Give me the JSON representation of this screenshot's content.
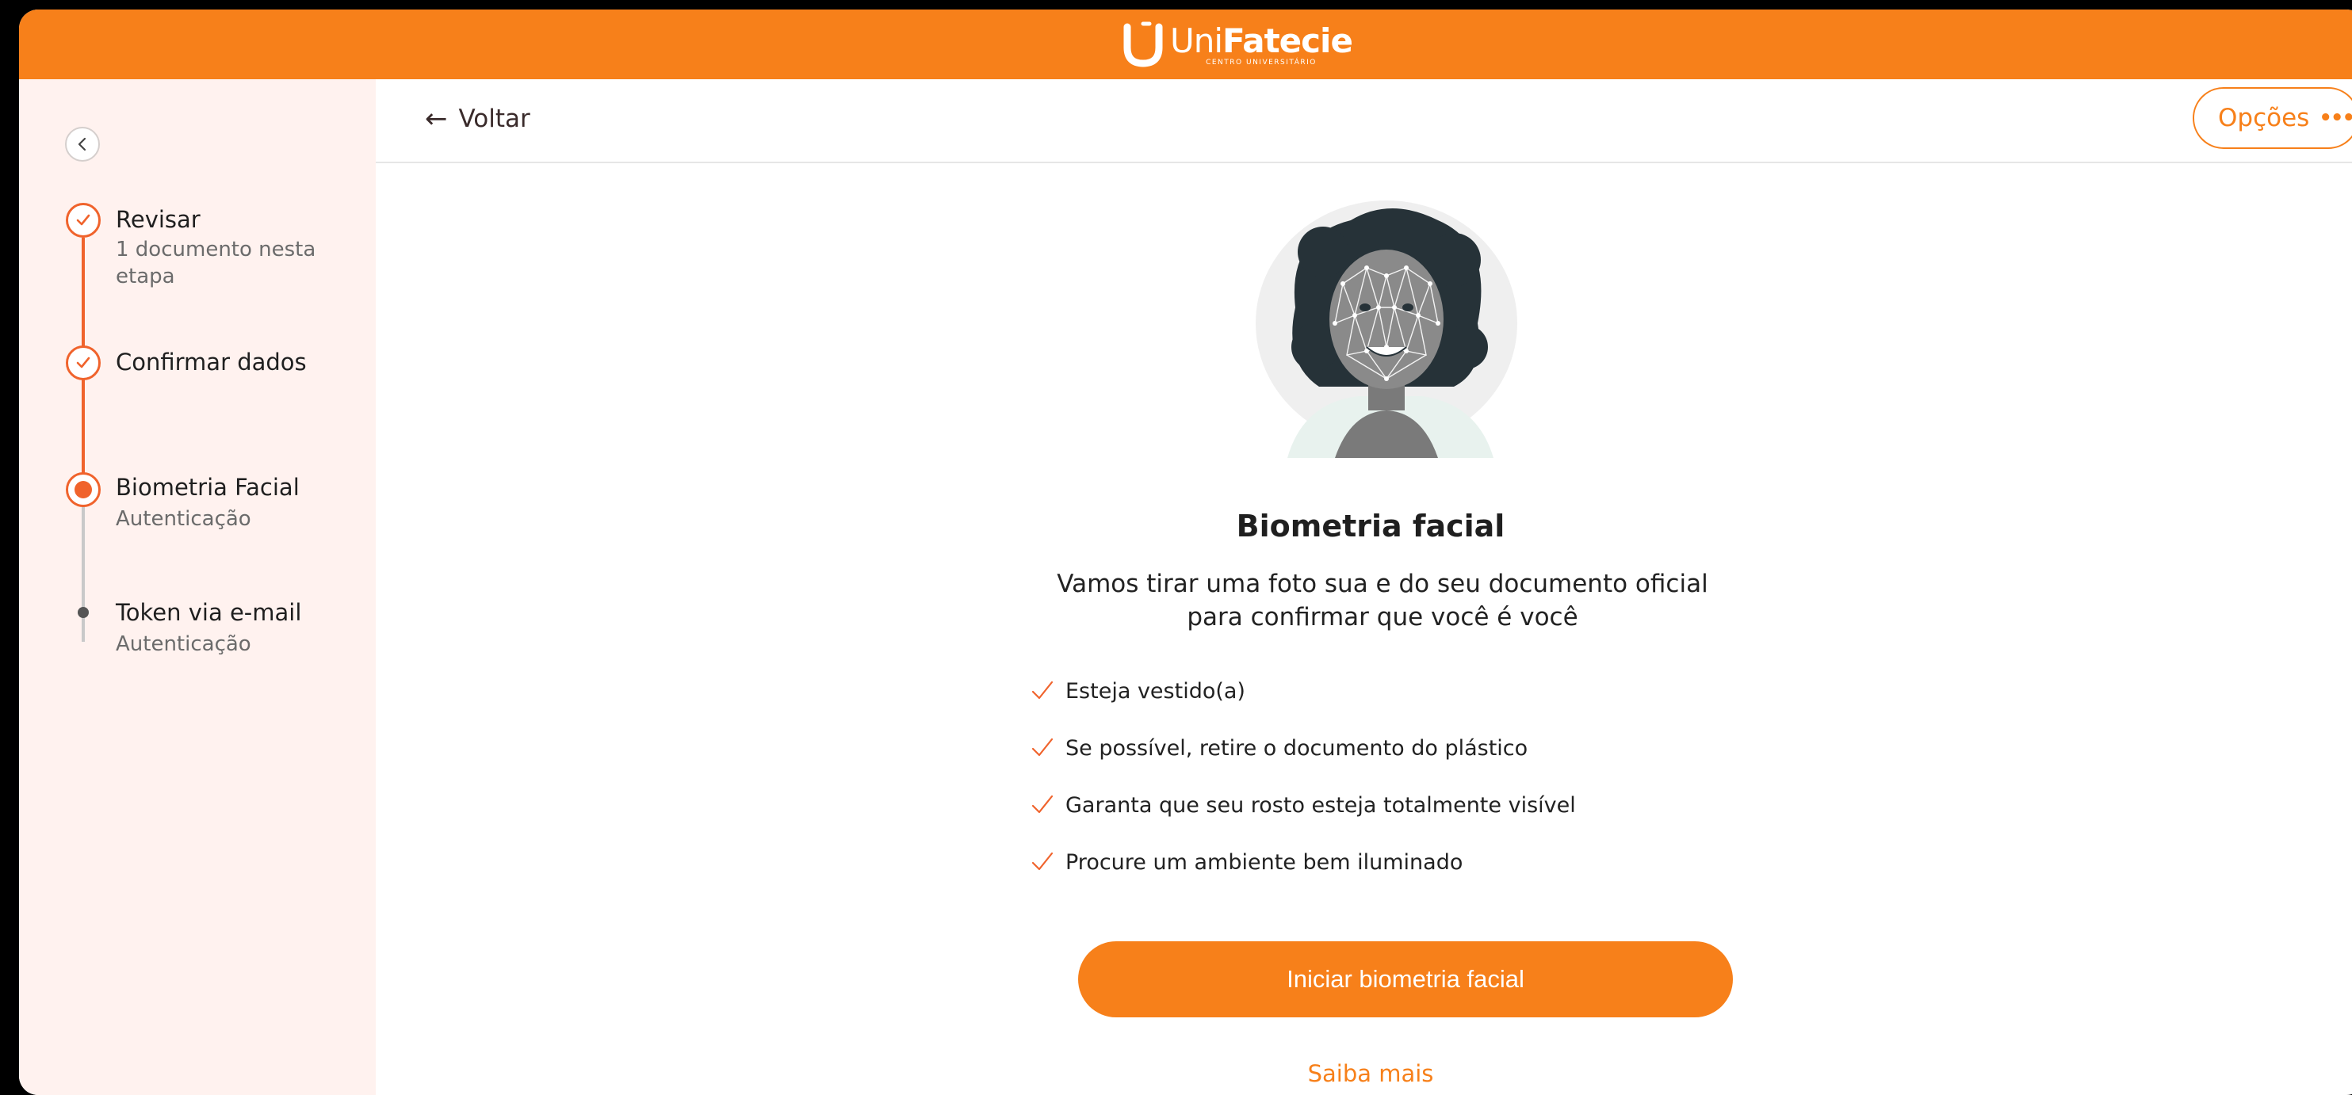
{
  "brand": {
    "name_prefix": "Uni",
    "name_main": "Fatecie",
    "subtitle": "CENTRO UNIVERSITÁRIO",
    "accent_color": "#f7801a",
    "step_color": "#f0632c"
  },
  "sidebar": {
    "collapse_icon": "chevron-left-icon",
    "steps": [
      {
        "title": "Revisar",
        "subtitle": "1 documento nesta etapa",
        "status": "done"
      },
      {
        "title": "Confirmar dados",
        "subtitle": "",
        "status": "done"
      },
      {
        "title": "Biometria Facial",
        "subtitle": "Autenticação",
        "status": "current"
      },
      {
        "title": "Token via e-mail",
        "subtitle": "Autenticação",
        "status": "pending"
      }
    ]
  },
  "header": {
    "back_label": "Voltar",
    "options_label": "Opções"
  },
  "content": {
    "title": "Biometria facial",
    "description": "Vamos tirar uma foto sua e do seu documento oficial para confirmar que você é você",
    "checklist": [
      "Esteja vestido(a)",
      "Se possível, retire o documento do plástico",
      "Garanta que seu rosto esteja totalmente visível",
      "Procure um ambiente bem iluminado"
    ],
    "primary_button": "Iniciar biometria facial",
    "learn_more": "Saiba mais"
  }
}
